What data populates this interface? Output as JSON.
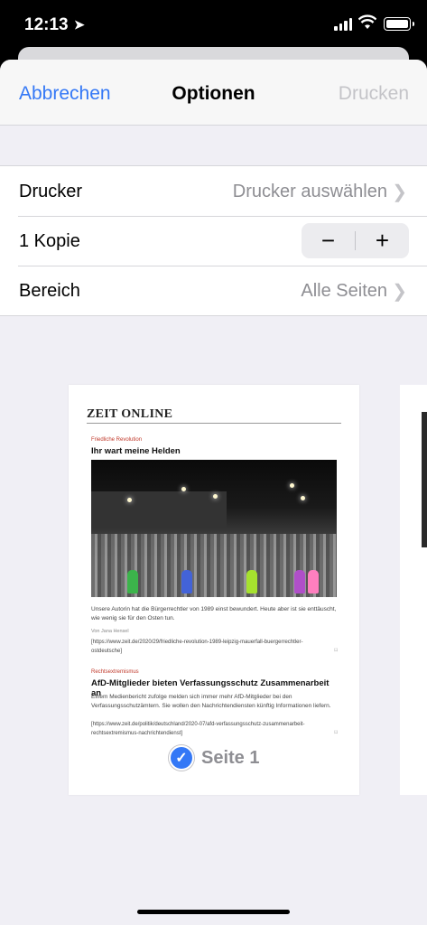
{
  "status": {
    "time": "12:13",
    "location_icon": "location-arrow-icon",
    "signal_icon": "cellular-signal-icon",
    "wifi_icon": "wifi-icon",
    "battery_icon": "battery-icon"
  },
  "nav": {
    "cancel": "Abbrechen",
    "title": "Optionen",
    "print": "Drucken"
  },
  "options": {
    "printer": {
      "label": "Drucker",
      "value": "Drucker auswählen"
    },
    "copies": {
      "label": "1 Kopie",
      "minus": "−",
      "plus": "+"
    },
    "range": {
      "label": "Bereich",
      "value": "Alle Seiten"
    }
  },
  "preview": {
    "logo": "ZEIT ONLINE",
    "article1": {
      "kicker": "Friedliche Revolution",
      "headline": "Ihr wart meine Helden",
      "teaser": "Unsere Autorin hat die Bürgerrechtler von 1989 einst bewundert. Heute aber ist sie enttäuscht, wie wenig sie für den Osten tun.",
      "byline": "Von Jana Hensel",
      "url": "[https://www.zeit.de/2020/29/friedliche-revolution-1989-leipzig-mauerfall-buergerrechtler-ostdeutsche]"
    },
    "article2": {
      "kicker": "Rechtsextremismus",
      "headline": "AfD-Mitglieder bieten Verfassungsschutz Zusammenarbeit an",
      "teaser": "Einem Medienbericht zufolge melden sich immer mehr AfD-Mitglieder bei den Verfassungsschutzämtern. Sie wollen den Nachrichtendiensten künftig Informationen liefern.",
      "url": "[https://www.zeit.de/politik/deutschland/2020-07/afd-verfassungsschutz-zusammenarbeit-rechtsextremismus-nachrichtendienst]"
    },
    "page_label": "Seite 1"
  },
  "colors": {
    "accent": "#3478f6",
    "secondary_text": "#8e8e93",
    "disabled": "#c4c4c8",
    "kicker": "#c0392b"
  }
}
